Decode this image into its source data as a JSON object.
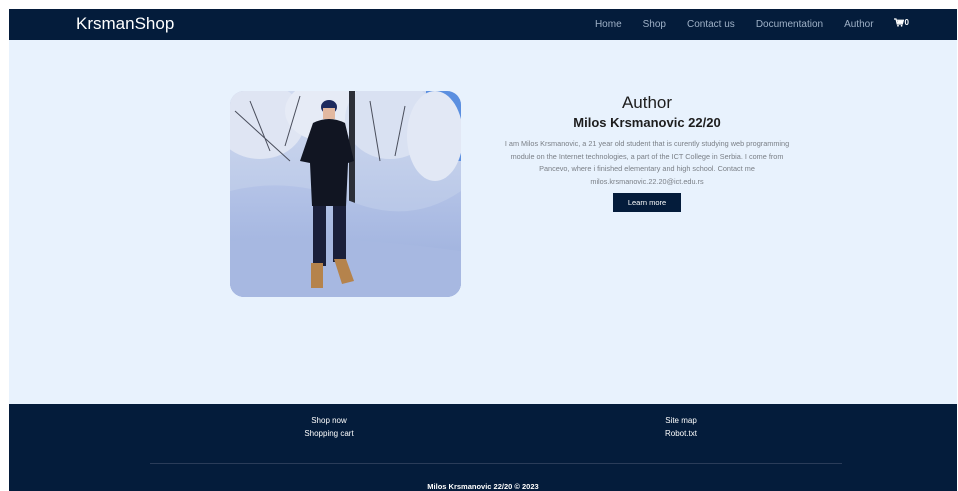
{
  "navbar": {
    "brand": "KrsmanShop",
    "links": [
      "Home",
      "Shop",
      "Contact us",
      "Documentation",
      "Author"
    ],
    "cart_count": "0",
    "cart_icon": "cart-icon"
  },
  "author": {
    "title": "Author",
    "name": "Milos Krsmanovic 22/20",
    "bio": "I am Milos Krsmanovic, a 21 year old student that is curently studying web programming module on the Internet technologies, a part of the ICT College in Serbia. I come from Pancevo, where i finished elementary and high school. Contact me milos.krsmanovic.22.20@ict.edu.rs",
    "button_label": "Learn more"
  },
  "footer": {
    "left_links": [
      "Shop now",
      "Shopping cart"
    ],
    "right_links": [
      "Site map",
      "Robot.txt"
    ],
    "copyright": "Milos Krsmanovic 22/20 © 2023"
  },
  "colors": {
    "nav_bg": "#041c3b",
    "page_bg": "#e8f2fd",
    "nav_link": "#9fb1c7"
  }
}
